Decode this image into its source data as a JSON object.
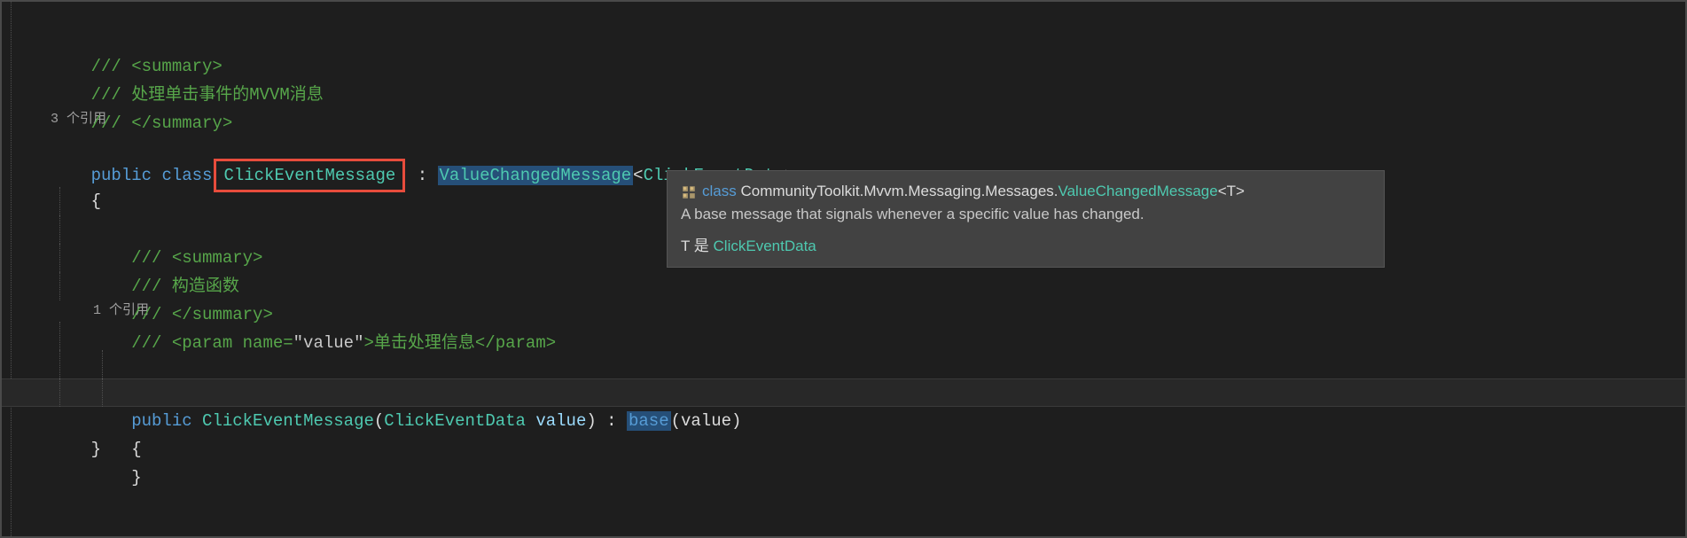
{
  "code": {
    "line1": "/// <summary>",
    "line2": "/// 处理单击事件的MVVM消息",
    "line3": "/// </summary>",
    "codelens1": "3 个引用",
    "line4_public": "public",
    "line4_class": "class",
    "line4_classname": "ClickEventMessage",
    "line4_colon": " : ",
    "line4_base": "ValueChangedMessage",
    "line4_generic_open": "<",
    "line4_generic_type": "ClickEventData",
    "line4_generic_close": ">",
    "line5": "{",
    "line6_slashes": "/// ",
    "line6_tag": "<summary>",
    "line7_slashes": "/// ",
    "line7_text": "构造函数",
    "line8_slashes": "/// ",
    "line8_tag": "</summary>",
    "line9_slashes": "/// ",
    "line9_open": "<param name=",
    "line9_value": "\"value\"",
    "line9_close": ">",
    "line9_text": "单击处理信息",
    "line9_end": "</param>",
    "codelens2": "1 个引用",
    "line10_public": "public",
    "line10_ctor": "ClickEventMessage",
    "line10_open": "(",
    "line10_paramtype": "ClickEventData",
    "line10_paramname": " value",
    "line10_close": ")",
    "line10_colon": " : ",
    "line10_base": "base",
    "line10_baseopen": "(",
    "line10_basearg": "value",
    "line10_baseclose": ")",
    "line11": "{",
    "line12": "}",
    "line13": "}"
  },
  "tooltip": {
    "keyword": "class",
    "namespace": " CommunityToolkit.Mvvm.Messaging.Messages.",
    "classname": "ValueChangedMessage",
    "generic": "<T>",
    "description": "A base message that signals whenever a specific value has changed.",
    "t_is": "T 是 ",
    "t_type": "ClickEventData"
  }
}
